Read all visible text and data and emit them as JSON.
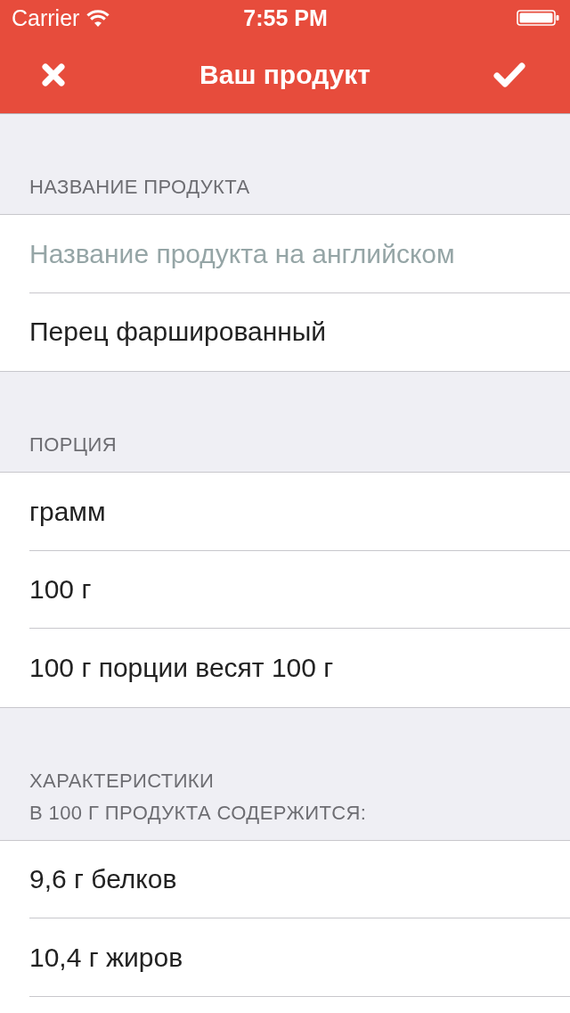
{
  "status_bar": {
    "carrier": "Carrier",
    "time": "7:55 PM"
  },
  "nav_bar": {
    "title": "Ваш продукт"
  },
  "sections": [
    {
      "header": "НАЗВАНИЕ ПРОДУКТА",
      "continues": false,
      "rows": [
        {
          "kind": "input",
          "placeholder": "Название продукта на английском"
        },
        {
          "kind": "input",
          "value": "Перец фаршированный"
        }
      ]
    },
    {
      "header": "ПОРЦИЯ",
      "continues": false,
      "rows": [
        {
          "kind": "option",
          "text": "грамм"
        },
        {
          "kind": "option",
          "text": "100 г"
        },
        {
          "kind": "option",
          "text": "100 г порции весят 100 г"
        }
      ]
    },
    {
      "header": "ХАРАКТЕРИСТИКИ\nВ 100 Г ПРОДУКТА СОДЕРЖИТСЯ:",
      "continues": true,
      "rows": [
        {
          "kind": "option",
          "text": "9,6 г белков"
        },
        {
          "kind": "option",
          "text": "10,4 г жиров"
        }
      ]
    }
  ]
}
